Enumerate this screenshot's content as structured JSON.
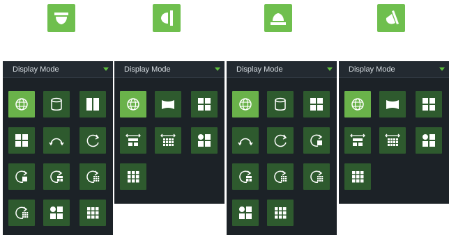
{
  "colors": {
    "accent": "#6fbf4e",
    "panel_bg": "#1c2227",
    "button_bg": "#2e5a2e",
    "button_selected_bg": "#6ab24a",
    "header_arrow": "#5fbf3f"
  },
  "mount_icons": [
    {
      "name": "ceiling-mount-icon"
    },
    {
      "name": "wall-mount-icon"
    },
    {
      "name": "desktop-mount-icon"
    },
    {
      "name": "tilt-mount-icon"
    }
  ],
  "panels": [
    {
      "title": "Display Mode",
      "selected": "original-fisheye-icon"
    },
    {
      "title": "Display Mode",
      "selected": "original-fisheye-icon"
    },
    {
      "title": "Display Mode",
      "selected": "original-fisheye-icon"
    },
    {
      "title": "Display Mode",
      "selected": "original-fisheye-icon"
    }
  ]
}
